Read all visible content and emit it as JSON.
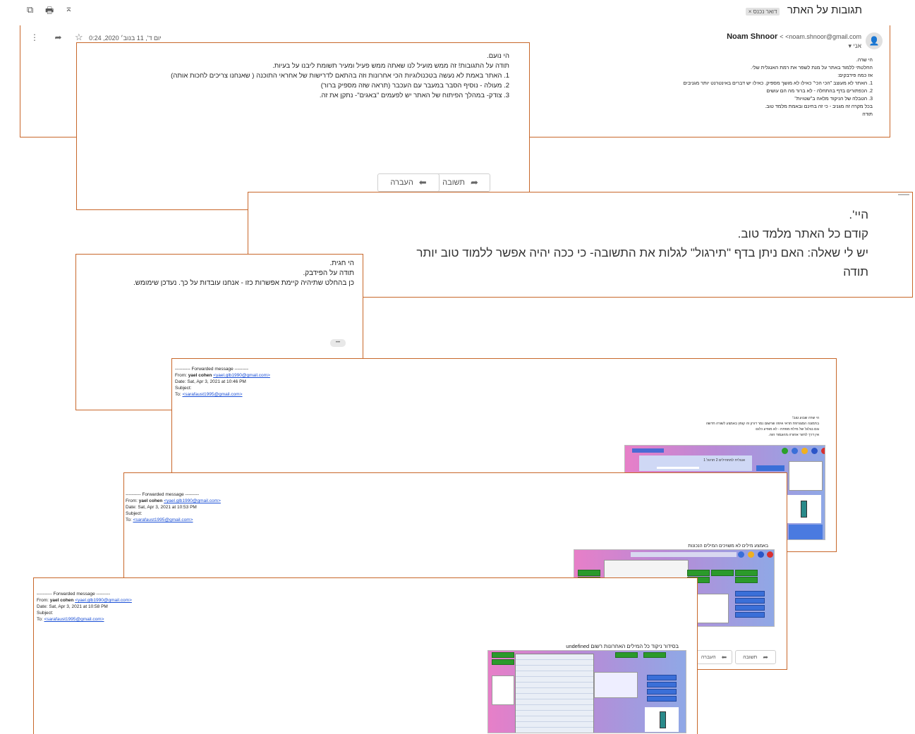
{
  "header": {
    "subject": "תגובות על האתר",
    "label_chip": "דואר נכנס ×",
    "icons": [
      "print-icon",
      "open-new-window-icon",
      "collapse-icon"
    ]
  },
  "message1": {
    "sender_name": "Noam Shnoor",
    "sender_email": "<noam.shnoor@gmail.com",
    "to_line": "אני ▾",
    "date": "יום ד', 11 בנוב׳ 2020, 0:24",
    "body": [
      "הי שרה.",
      "החלטתי ללמוד באתר על מנת לשפר את רמת האנגלית שלי.",
      "אז כמה פידבקים:",
      "1. האתר לא מעוצב \"הכי הכי\" כאילו לא מושך מספיק. כאילו יש דברים באינטרנט יותר מגניבים",
      "2. הכפתורים בדף בהתחלה - לא ברור מה הם עושים",
      "3. הטבלה של הניקוד מלאה ב\"שטויות\"",
      "בכל מקרה זה מגניב - כי זה בחינם ובאמת מלמד טוב.",
      "תודה"
    ]
  },
  "reply1": {
    "body": [
      "הי נועם.",
      "תודה על התגובות! זה ממש מועיל לנו שאתה ממש פעיל ומעיר תשומת ליבנו על בעיות.",
      "1. האתר באמת לא נעשה בטכנולוגיות הכי אחרונות וזה בהתאם לדרישות של אחראי התוכנה ( שאנחנו צריכים לחכות אותה)",
      "2. מעולה - נוסיף הסבר במעבר עם העכבר (תראה שזה מספיק ברור)",
      "3. צודק- במהלך הפיתוח של האתר יש לפעמים \"באגים\"- נתקן את זה."
    ],
    "reply_button": "תשובה",
    "forward_button": "העברה"
  },
  "message2": {
    "body": [
      "היי'.",
      "קודם כל האתר מלמד טוב.",
      "יש לי שאלה: האם ניתן בדף \"תירגול\" לגלות את התשובה- כי ככה יהיה אפשר ללמוד טוב יותר",
      "תודה"
    ]
  },
  "reply2": {
    "body": [
      "הי חגית.",
      "תודה על הפידבק.",
      "כן בהחלט שתיהיה קיימת אפשרות כזו - אנחנו עובדות על כך. נעדכן שימומש."
    ],
    "more_button": "•••"
  },
  "forward1": {
    "header": "---------- Forwarded message ---------",
    "from_label": "From: ",
    "from_name": "yael cohen",
    "from_email": "<yael.glb1990@gmail.com>",
    "date": "Date: Sat, Apr 3, 2021 at 10:46 PM",
    "subject": "Subject:",
    "to_label": "To: ",
    "to_email": "<sarafaust1995@gmail.com>",
    "body": [
      "הי שרה שבוע טוב!",
      "בתמונה המצורפת תראי איפה שרשום נמר דורון זה קופץ באמצע לשורה חדשה",
      "וגם בגלגל של מילת מפתח - לא מופיע כלום",
      "אין דרך לחזור אחורה מהעמוד הזה."
    ],
    "screenshot_caption": "אנגלית למתחילים 2 תרגול 1"
  },
  "forward2": {
    "header": "---------- Forwarded message ---------",
    "from_label": "From: ",
    "from_name": "yael cohen",
    "from_email": "<yael.glb1990@gmail.com>",
    "date": "Date: Sat, Apr 3, 2021 at 10:53 PM",
    "subject": "Subject:",
    "to_label": "To: ",
    "to_email": "<sarafaust1995@gmail.com>",
    "body": "באמצע מילים לא משויכים המילים הנכונות",
    "reply_button": "תשובה",
    "forward_button": "העברה"
  },
  "forward3": {
    "header": "---------- Forwarded message ---------",
    "from_label": "From: ",
    "from_name": "yael cohen",
    "from_email": "<yael.glb1990@gmail.com>",
    "date": "Date: Sat, Apr 3, 2021 at 10:58 PM",
    "subject": "Subject:",
    "to_label": "To: ",
    "to_email": "<sarafaust1995@gmail.com>",
    "body": "בסידור ניקוד כל המילים האחרונות רשום undefined"
  },
  "colors": {
    "border": "#c8672a",
    "link": "#1a4fd6",
    "green": "#2b9a2b",
    "blue": "#3a6fd8"
  }
}
